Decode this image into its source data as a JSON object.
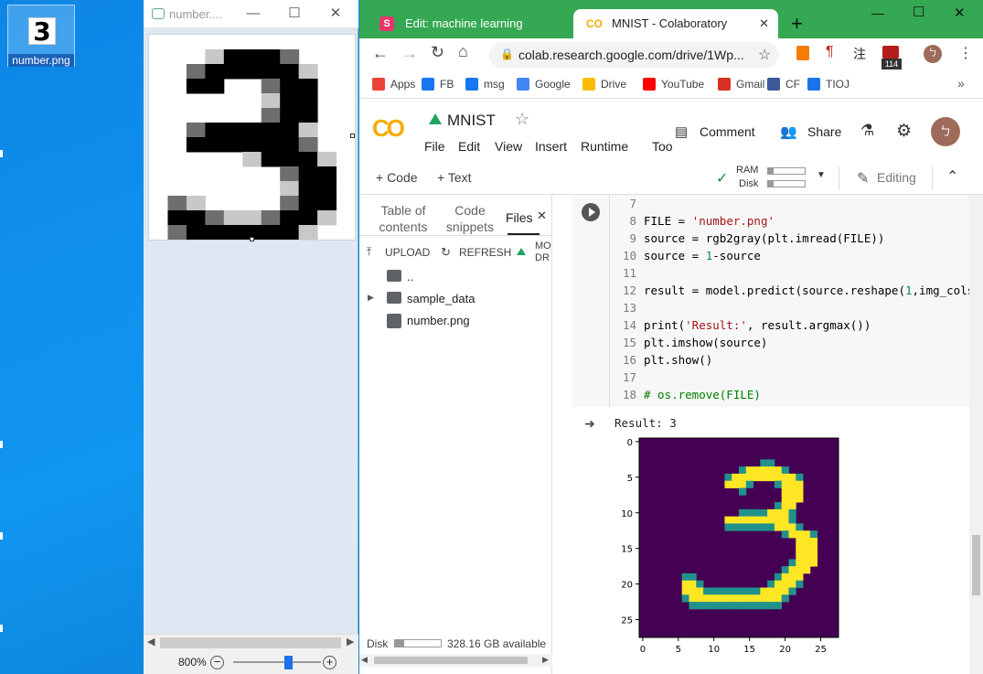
{
  "desktop": {
    "icon_label": "number.png",
    "icon_glyph": "3"
  },
  "viewer": {
    "title": "number....",
    "zoom": "800%",
    "zoom_level": 0.62,
    "digit_pixels": [
      [
        0,
        0,
        0,
        0,
        0,
        0,
        0,
        0,
        0,
        0,
        0
      ],
      [
        0,
        0,
        0,
        1,
        3,
        3,
        3,
        2,
        0,
        0,
        0
      ],
      [
        0,
        0,
        2,
        3,
        3,
        3,
        3,
        3,
        1,
        0,
        0
      ],
      [
        0,
        0,
        3,
        3,
        0,
        0,
        2,
        3,
        3,
        0,
        0
      ],
      [
        0,
        0,
        0,
        0,
        0,
        0,
        1,
        3,
        3,
        0,
        0
      ],
      [
        0,
        0,
        0,
        0,
        0,
        0,
        2,
        3,
        3,
        0,
        0
      ],
      [
        0,
        0,
        2,
        3,
        3,
        3,
        3,
        3,
        1,
        0,
        0
      ],
      [
        0,
        0,
        3,
        3,
        3,
        3,
        3,
        3,
        2,
        0,
        0
      ],
      [
        0,
        0,
        0,
        0,
        0,
        1,
        3,
        3,
        3,
        1,
        0
      ],
      [
        0,
        0,
        0,
        0,
        0,
        0,
        0,
        2,
        3,
        3,
        0
      ],
      [
        0,
        0,
        0,
        0,
        0,
        0,
        0,
        1,
        3,
        3,
        0
      ],
      [
        0,
        2,
        1,
        0,
        0,
        0,
        0,
        2,
        3,
        3,
        0
      ],
      [
        0,
        3,
        3,
        2,
        1,
        1,
        2,
        3,
        3,
        1,
        0
      ],
      [
        0,
        2,
        3,
        3,
        3,
        3,
        3,
        3,
        1,
        0,
        0
      ]
    ]
  },
  "browser": {
    "tabs": [
      {
        "label": "Edit: machine learning",
        "icon": "S",
        "color": "#e8356c",
        "active": false
      },
      {
        "label": "MNIST - Colaboratory",
        "icon": "CO",
        "color": "#f9ab00",
        "active": true
      }
    ],
    "new_tab": "+",
    "url": "colab.research.google.com/drive/1Wp...",
    "bookmarks": [
      {
        "label": "Apps",
        "color": "#ea4335"
      },
      {
        "label": "FB",
        "color": "#1877f2"
      },
      {
        "label": "msg",
        "color": "#1877f2"
      },
      {
        "label": "Google",
        "color": "#4285f4"
      },
      {
        "label": "Drive",
        "color": "#fbbc04"
      },
      {
        "label": "YouTube",
        "color": "#ff0000"
      },
      {
        "label": "Gmail",
        "color": "#d93025"
      },
      {
        "label": "CF",
        "color": "#3b5998"
      },
      {
        "label": "TIOJ",
        "color": "#1a73e8"
      }
    ],
    "ext_badge": "114",
    "ext_glyph": "注"
  },
  "colab": {
    "notebook_title": "MNIST",
    "menu": [
      "File",
      "Edit",
      "View",
      "Insert",
      "Runtime",
      "Too"
    ],
    "comment": "Comment",
    "share": "Share",
    "avatar": "ㄅ",
    "add_code": "+ Code",
    "add_text": "+ Text",
    "ram": "RAM",
    "disk": "Disk",
    "editing": "Editing",
    "side_tabs": [
      "Table of contents",
      "Code snippets",
      "Files"
    ],
    "upload": "UPLOAD",
    "refresh": "REFRESH",
    "mount": "MO DR",
    "files": [
      {
        "name": "..",
        "type": "up"
      },
      {
        "name": "sample_data",
        "type": "folder"
      },
      {
        "name": "number.png",
        "type": "file"
      }
    ],
    "disk_label": "Disk",
    "disk_available": "328.16 GB available",
    "disk_fraction": 0.2,
    "code_lines": [
      {
        "n": "7",
        "parts": []
      },
      {
        "n": "8",
        "parts": [
          [
            "FILE = ",
            ""
          ],
          [
            "'number.png'",
            "str"
          ]
        ]
      },
      {
        "n": "9",
        "parts": [
          [
            "source = rgb2gray(plt.imread(FILE))",
            ""
          ]
        ]
      },
      {
        "n": "10",
        "parts": [
          [
            "source = ",
            ""
          ],
          [
            "1",
            "num"
          ],
          [
            "-source",
            ""
          ]
        ]
      },
      {
        "n": "11",
        "parts": []
      },
      {
        "n": "12",
        "parts": [
          [
            "result = model.predict(source.reshape(",
            ""
          ],
          [
            "1",
            "num"
          ],
          [
            ",img_cols",
            ""
          ]
        ]
      },
      {
        "n": "13",
        "parts": []
      },
      {
        "n": "14",
        "parts": [
          [
            "print(",
            ""
          ],
          [
            "'Result:'",
            "str"
          ],
          [
            ", result.argmax())",
            ""
          ]
        ]
      },
      {
        "n": "15",
        "parts": [
          [
            "plt.imshow(source)",
            ""
          ]
        ]
      },
      {
        "n": "16",
        "parts": [
          [
            "plt.show()",
            ""
          ]
        ]
      },
      {
        "n": "17",
        "parts": []
      },
      {
        "n": "18",
        "parts": [
          [
            "# os.remove(FILE)",
            "cmt"
          ]
        ]
      }
    ],
    "output_text": "Result: 3"
  },
  "chart_data": {
    "type": "heatmap",
    "title": "",
    "x_ticks": [
      0,
      5,
      10,
      15,
      20,
      25
    ],
    "y_ticks": [
      0,
      5,
      10,
      15,
      20,
      25
    ],
    "xlim": [
      -0.5,
      27.5
    ],
    "ylim": [
      27.5,
      -0.5
    ],
    "colormap": "viridis",
    "low_color": "#440154",
    "high_color": "#fde725",
    "mid_color": "#21918c",
    "image_rows": [
      "............................",
      "............................",
      "............................",
      ".................mm.........",
      "..............myyyyym.......",
      "............myyyyyyyyym.....",
      "............yyym...myyy.....",
      "..............m.....yyy.....",
      "....................yyy.....",
      "...................myy......",
      "..............mmmmyyym......",
      "............yyyyyyyyym......",
      "............mmmmmmmyyym.....",
      "....................myyym...",
      "......................yyy...",
      "......................yyy...",
      "......................yyy...",
      ".....................myyy...",
      "....................myyy....",
      "......mm...........myyy.....",
      "......yym.........myyym.....",
      "......yyymmmmmmmmyyyym......",
      "......myyyyyyyyyyyyym.......",
      ".......mmmmmmmmmmmmm........",
      "............................",
      "............................",
      "............................",
      "............................"
    ]
  }
}
